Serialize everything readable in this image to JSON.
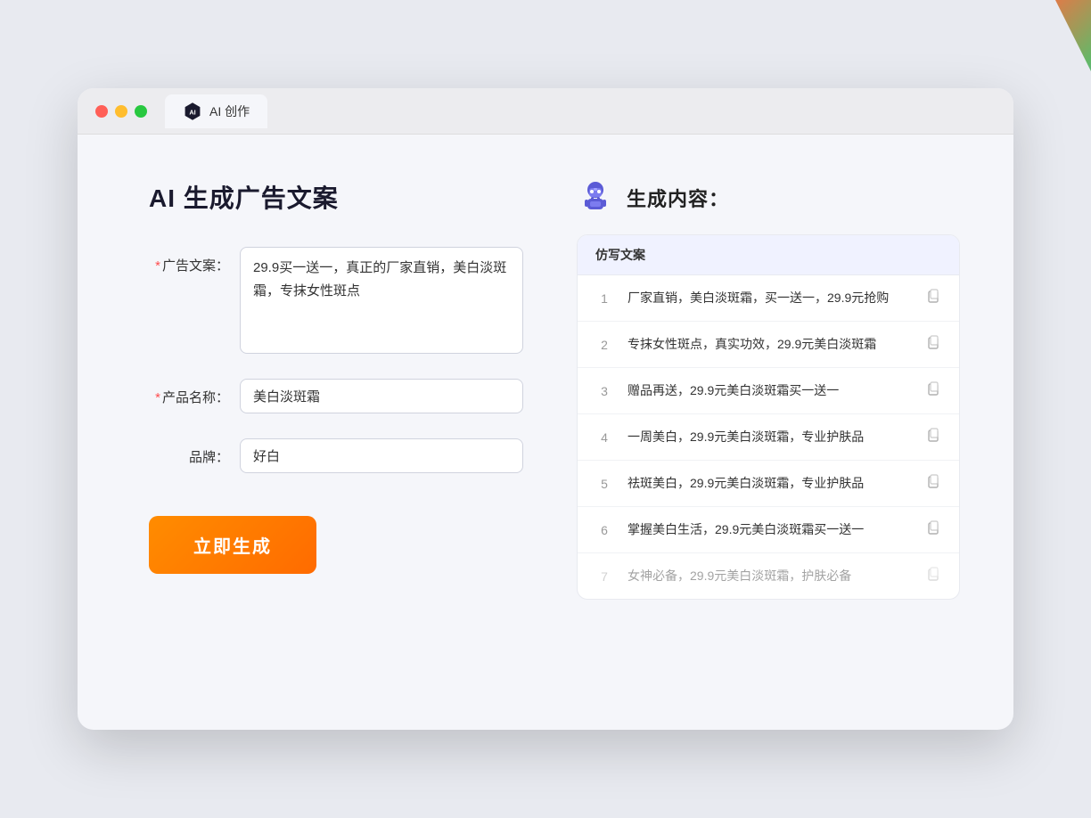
{
  "browser": {
    "tab_label": "AI 创作",
    "window_buttons": {
      "close": "close",
      "minimize": "minimize",
      "maximize": "maximize"
    }
  },
  "left_panel": {
    "title": "AI 生成广告文案",
    "form": {
      "ad_copy_label": "广告文案：",
      "ad_copy_placeholder": "29.9买一送一，真正的厂家直销，美白淡斑霜，专抹女性斑点",
      "ad_copy_required": true,
      "product_name_label": "产品名称：",
      "product_name_value": "美白淡斑霜",
      "product_name_required": true,
      "brand_label": "品牌：",
      "brand_value": "好白",
      "brand_required": false,
      "generate_button": "立即生成"
    }
  },
  "right_panel": {
    "title": "生成内容：",
    "column_header": "仿写文案",
    "results": [
      {
        "num": "1",
        "text": "厂家直销，美白淡斑霜，买一送一，29.9元抢购",
        "dimmed": false
      },
      {
        "num": "2",
        "text": "专抹女性斑点，真实功效，29.9元美白淡斑霜",
        "dimmed": false
      },
      {
        "num": "3",
        "text": "赠品再送，29.9元美白淡斑霜买一送一",
        "dimmed": false
      },
      {
        "num": "4",
        "text": "一周美白，29.9元美白淡斑霜，专业护肤品",
        "dimmed": false
      },
      {
        "num": "5",
        "text": "祛斑美白，29.9元美白淡斑霜，专业护肤品",
        "dimmed": false
      },
      {
        "num": "6",
        "text": "掌握美白生活，29.9元美白淡斑霜买一送一",
        "dimmed": false
      },
      {
        "num": "7",
        "text": "女神必备，29.9元美白淡斑霜，护肤必备",
        "dimmed": true
      }
    ]
  }
}
